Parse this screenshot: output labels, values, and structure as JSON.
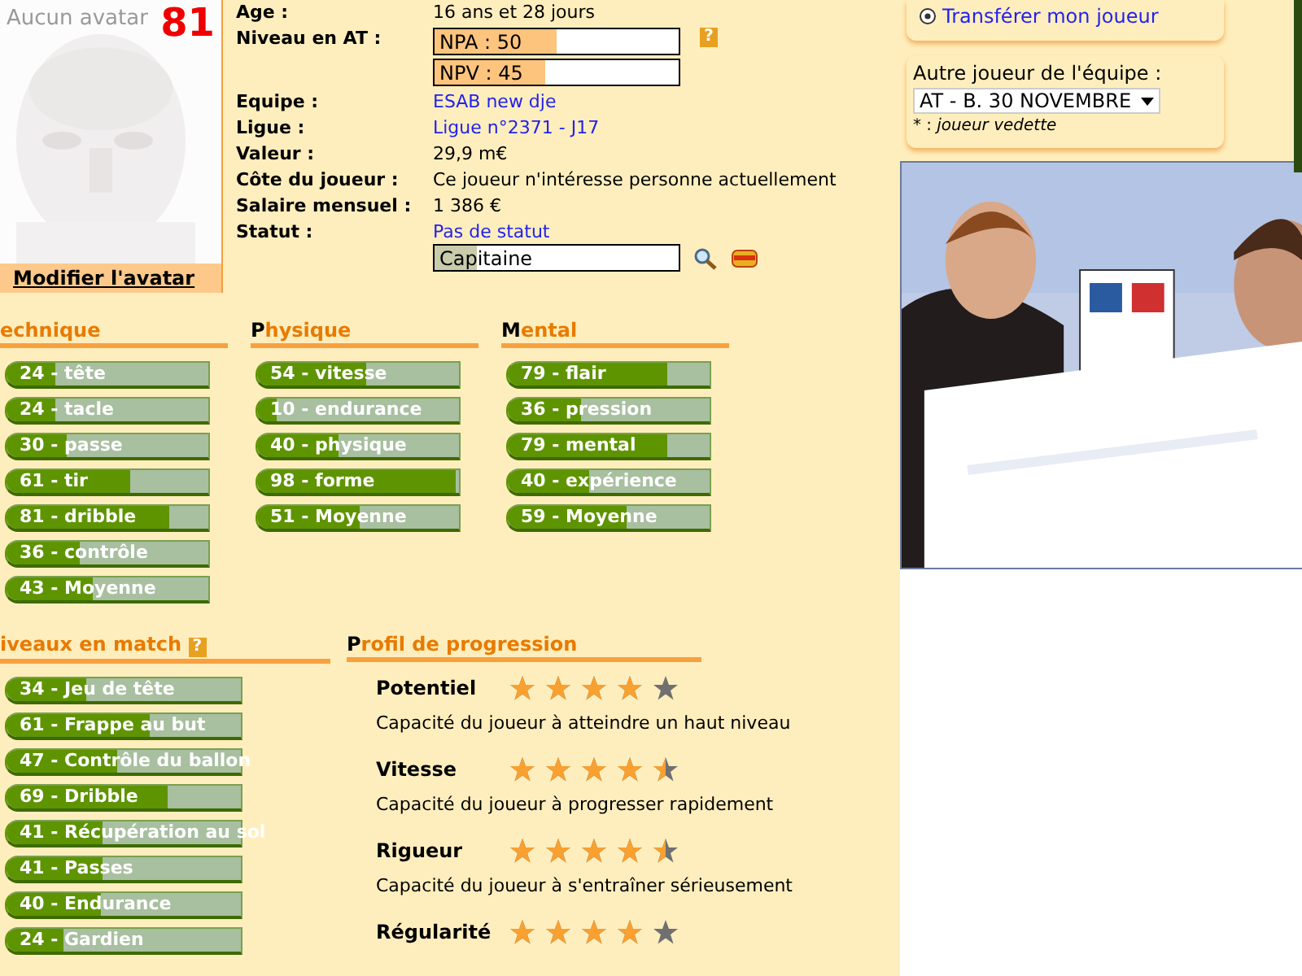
{
  "avatar": {
    "caption": "Aucun avatar",
    "rating": "81",
    "edit_link": "Modifier l'avatar"
  },
  "info": {
    "age": {
      "label": "Age :",
      "value": "16 ans et 28 jours"
    },
    "level": {
      "label": "Niveau en AT :",
      "help": "?",
      "bars": [
        {
          "label": "NPA : 50",
          "level": 0.5
        },
        {
          "label": "NPV : 45",
          "level": 0.45
        }
      ]
    },
    "rows": [
      {
        "label": "Equipe :",
        "value": "ESAB new dje",
        "kind": "link"
      },
      {
        "label": "Ligue :",
        "value": "Ligue n°2371 - J17",
        "kind": "link"
      },
      {
        "label": "Valeur :",
        "value": "29,9 m€",
        "kind": "text"
      },
      {
        "label": "Côte du joueur :",
        "value": "Ce joueur n'intéresse personne actuellement",
        "kind": "text"
      },
      {
        "label": "Salaire mensuel :",
        "value": "1 386 €",
        "kind": "text"
      }
    ],
    "status": {
      "label": "Statut :",
      "value": "Pas de statut",
      "role": {
        "label": "Capitaine",
        "level": 0.17
      }
    }
  },
  "skills": [
    {
      "title": "echnique",
      "dark_initial": false,
      "bars": [
        {
          "label": "24  - tête",
          "level": 0.24
        },
        {
          "label": "24  - tacle",
          "level": 0.24
        },
        {
          "label": "30  - passe",
          "level": 0.3
        },
        {
          "label": "61  - tir",
          "level": 0.61
        },
        {
          "label": "81  - dribble",
          "level": 0.81
        },
        {
          "label": "36  - contrôle",
          "level": 0.36
        },
        {
          "label": "43  - Moyenne",
          "level": 0.43
        }
      ]
    },
    {
      "title": "Physique",
      "dark_initial": true,
      "bars": [
        {
          "label": "54  - vitesse",
          "level": 0.54
        },
        {
          "label": "10  - endurance",
          "level": 0.1
        },
        {
          "label": "40  - physique",
          "level": 0.4
        },
        {
          "label": "98  - forme",
          "level": 0.98
        },
        {
          "label": "51  - Moyenne",
          "level": 0.51
        }
      ]
    },
    {
      "title": "Mental",
      "dark_initial": true,
      "bars": [
        {
          "label": "79  - flair",
          "level": 0.79
        },
        {
          "label": "36  - pression",
          "level": 0.36
        },
        {
          "label": "79  - mental",
          "level": 0.79
        },
        {
          "label": "40  - expérience",
          "level": 0.4
        },
        {
          "label": "59  - Moyenne",
          "level": 0.59
        }
      ]
    }
  ],
  "match": {
    "title": "iveaux en match",
    "dark_initial": false,
    "help": "?",
    "bars": [
      {
        "label": "34  - Jeu de tête",
        "level": 0.34
      },
      {
        "label": "61  - Frappe au but",
        "level": 0.61
      },
      {
        "label": "47  - Contrôle du ballon",
        "level": 0.47
      },
      {
        "label": "69  - Dribble",
        "level": 0.69
      },
      {
        "label": "41  - Récupération au sol",
        "level": 0.41
      },
      {
        "label": "41  - Passes",
        "level": 0.41
      },
      {
        "label": "40  - Endurance",
        "level": 0.4
      },
      {
        "label": "24  - Gardien",
        "level": 0.24
      }
    ]
  },
  "progression": {
    "title": "Profil de progression",
    "dark_initial": true,
    "items": [
      {
        "name": "Potentiel",
        "stars": 4,
        "description": "Capacité du joueur à atteindre un haut niveau"
      },
      {
        "name": "Vitesse",
        "stars": 4.5,
        "description": "Capacité du joueur à progresser rapidement"
      },
      {
        "name": "Rigueur",
        "stars": 4.5,
        "description": "Capacité du joueur à s'entraîner sérieusement"
      },
      {
        "name": "Régularité",
        "stars": 4
      }
    ]
  },
  "sidebar": {
    "transfer_link": "Transférer mon joueur",
    "other_player": {
      "label": "Autre joueur de l'équipe :",
      "value": "AT - B. 30 NOVEMBRE",
      "legend_mark": "* :",
      "legend_text": "joueur vedette"
    }
  }
}
